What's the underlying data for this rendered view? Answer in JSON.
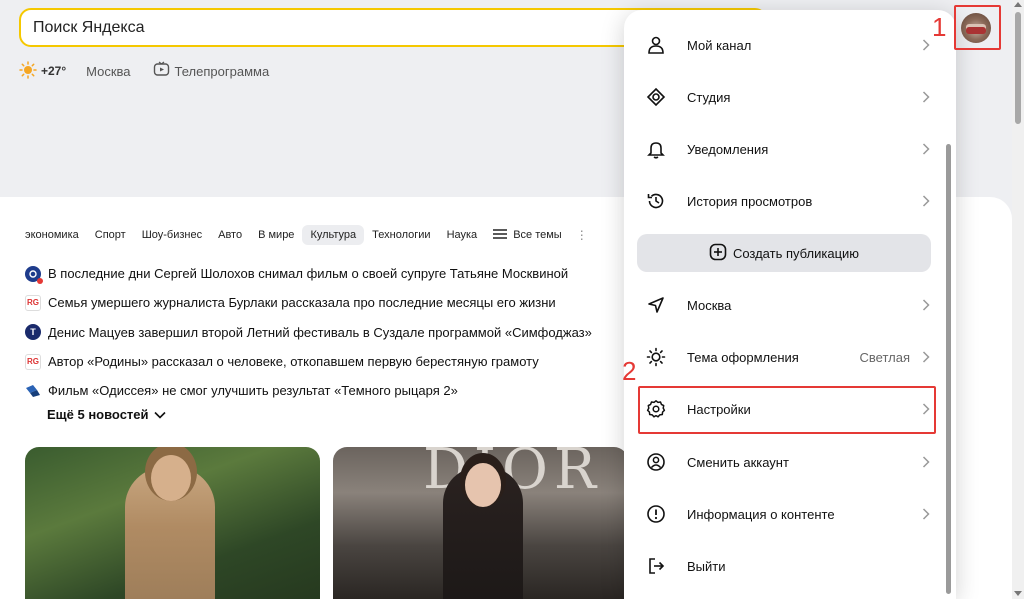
{
  "search": {
    "placeholder": "Поиск Яндекса"
  },
  "info": {
    "temperature": "+27°",
    "city": "Москва",
    "tv": "Телепрограмма"
  },
  "topics": [
    "экономика",
    "Спорт",
    "Шоу-бизнес",
    "Авто",
    "В мире",
    "Культура",
    "Технологии",
    "Наука"
  ],
  "topics_all": "Все темы",
  "active_topic": "Культура",
  "news": [
    "В последние дни Сергей Шолохов снимал фильм о своей супруге Татьяне Москвиной",
    "Семья умершего журналиста Бурлаки рассказала про последние месяцы его жизни",
    "Денис Мацуев завершил второй Летний фестиваль в Суздале программой «Симфоджаз»",
    "Автор «Родины» рассказал о человеке, откопавшем первую берестяную грамоту",
    "Фильм «Одиссея» не смог улучшить результат «Темного рыцаря 2»"
  ],
  "news_sources": [
    "",
    "RG",
    "T",
    "RG",
    ""
  ],
  "more_news": "Ещё 5 новостей",
  "photo_brand": "DIOR",
  "menu": {
    "my_channel": "Мой канал",
    "studio": "Студия",
    "notifications": "Уведомления",
    "history": "История просмотров",
    "create": "Создать публикацию",
    "city": "Москва",
    "theme": "Тема оформления",
    "theme_value": "Светлая",
    "settings": "Настройки",
    "switch_account": "Сменить аккаунт",
    "content_info": "Информация о контенте",
    "logout": "Выйти"
  },
  "annotations": {
    "first": "1",
    "second": "2"
  },
  "colors": {
    "search_border": "#f5c800",
    "annotation": "#e53935"
  }
}
